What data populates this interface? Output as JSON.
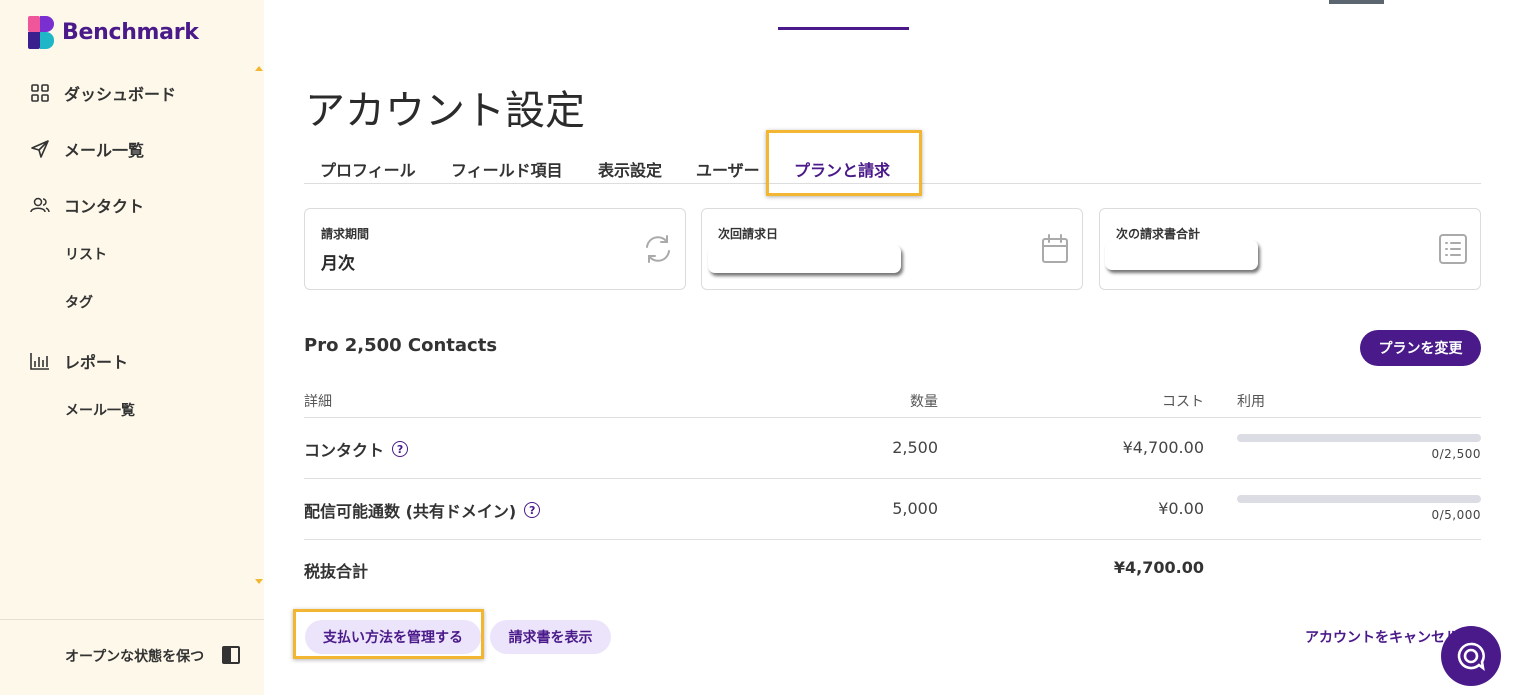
{
  "brand": {
    "name": "Benchmark"
  },
  "sidebar": {
    "items": [
      {
        "label": "ダッシュボード",
        "icon": "grid-icon"
      },
      {
        "label": "メール一覧",
        "icon": "send-icon"
      },
      {
        "label": "コンタクト",
        "icon": "users-icon"
      },
      {
        "label": "レポート",
        "icon": "bar-chart-icon"
      }
    ],
    "subitems": {
      "contacts_list": "リスト",
      "contacts_tags": "タグ",
      "reports_email": "メール一覧"
    },
    "footer_label": "オープンな状態を保つ"
  },
  "page": {
    "title": "アカウント設定"
  },
  "tabs": [
    {
      "label": "プロフィール"
    },
    {
      "label": "フィールド項目"
    },
    {
      "label": "表示設定"
    },
    {
      "label": "ユーザー"
    },
    {
      "label": "プランと請求",
      "active": true
    }
  ],
  "cards": {
    "billing_period": {
      "label": "請求期間",
      "value": "月次"
    },
    "next_billing_date": {
      "label": "次回請求日",
      "value": ""
    },
    "next_invoice_total": {
      "label": "次の請求書合計",
      "value": ""
    }
  },
  "plan": {
    "name": "Pro 2,500 Contacts",
    "change_button": "プランを変更"
  },
  "table": {
    "headers": {
      "detail": "詳細",
      "quantity": "数量",
      "cost": "コスト",
      "usage": "利用"
    },
    "rows": [
      {
        "label": "コンタクト",
        "quantity": "2,500",
        "cost": "¥4,700.00",
        "usage_text": "0/2,500",
        "usage_fraction": 0
      },
      {
        "label": "配信可能通数 (共有ドメイン)",
        "quantity": "5,000",
        "cost": "¥0.00",
        "usage_text": "0/5,000",
        "usage_fraction": 0
      }
    ],
    "subtotal_label": "税抜合計",
    "subtotal_value": "¥4,700.00"
  },
  "actions": {
    "manage_payment": "支払い方法を管理する",
    "view_invoices": "請求書を表示",
    "cancel_account": "アカウントをキャンセル"
  },
  "help_symbol": "?",
  "colors": {
    "brand_purple": "#4a1a8a",
    "highlight": "#f2b632",
    "sidebar_bg": "#fdf8ea"
  }
}
